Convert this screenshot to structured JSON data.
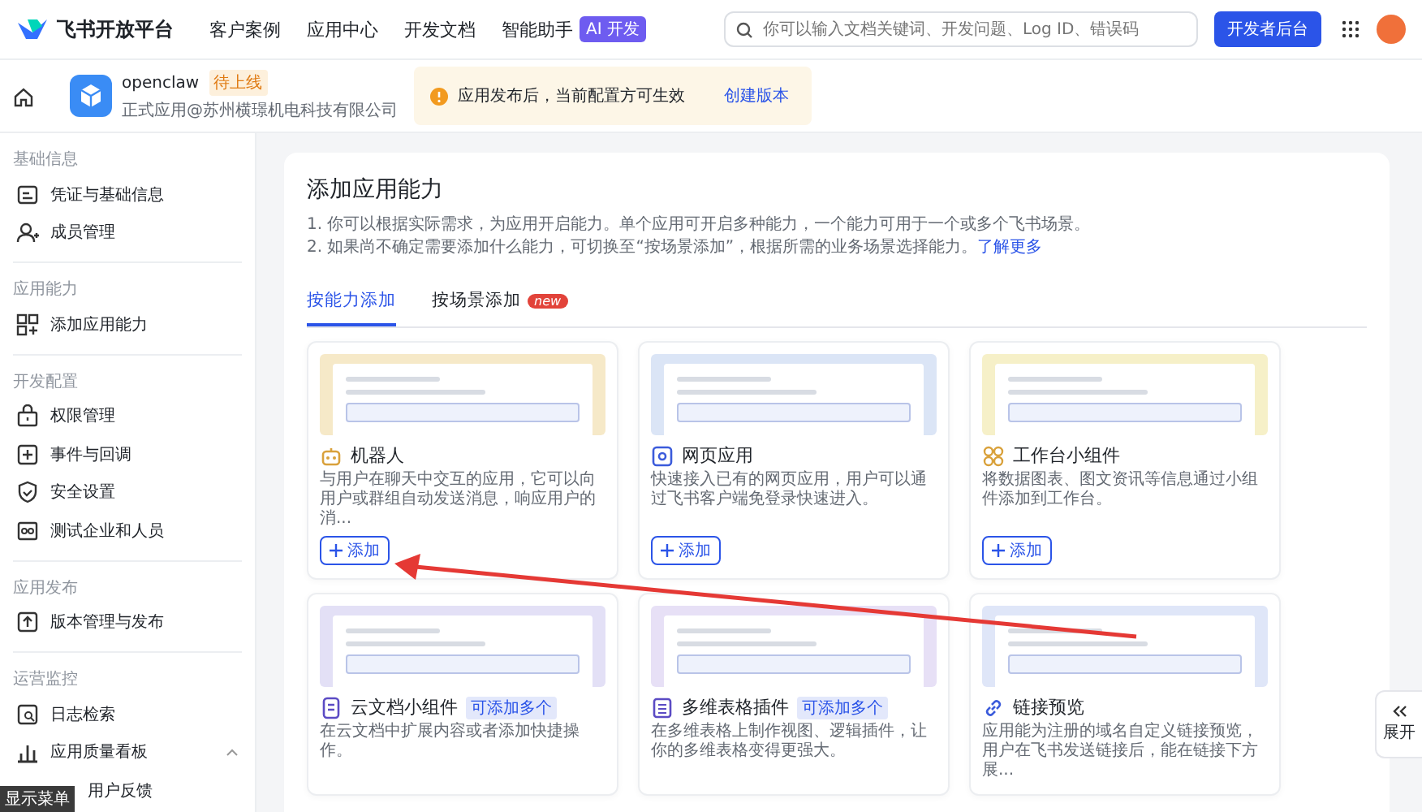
{
  "header": {
    "brand": "飞书开放平台",
    "nav": [
      {
        "label": "客户案例"
      },
      {
        "label": "应用中心"
      },
      {
        "label": "开发文档"
      },
      {
        "label": "智能助手",
        "badge": "AI 开发"
      }
    ],
    "search": {
      "placeholder": "你可以输入文档关键词、开发问题、Log ID、错误码"
    },
    "console_button": "开发者后台"
  },
  "app_bar": {
    "app_name": "openclaw",
    "status_badge": "待上线",
    "subtitle": "正式应用@苏州横璟机电科技有限公司",
    "notice": "应用发布后，当前配置方可生效",
    "notice_link": "创建版本"
  },
  "sidebar": {
    "groups": [
      {
        "heading": "基础信息",
        "items": [
          {
            "label": "凭证与基础信息",
            "kind": "card",
            "selected": false
          },
          {
            "label": "成员管理",
            "kind": "user",
            "selected": false
          }
        ]
      },
      {
        "heading": "应用能力",
        "items": [
          {
            "label": "添加应用能力",
            "kind": "grid",
            "selected": false
          }
        ]
      },
      {
        "heading": "开发配置",
        "items": [
          {
            "label": "权限管理",
            "kind": "lock",
            "selected": false
          },
          {
            "label": "事件与回调",
            "kind": "event",
            "selected": false
          },
          {
            "label": "安全设置",
            "kind": "shield",
            "selected": false
          },
          {
            "label": "测试企业和人员",
            "kind": "test",
            "selected": false
          }
        ]
      },
      {
        "heading": "应用发布",
        "items": [
          {
            "label": "版本管理与发布",
            "kind": "upload",
            "selected": false
          }
        ]
      },
      {
        "heading": "运营监控",
        "items": [
          {
            "label": "日志检索",
            "kind": "log",
            "selected": false
          },
          {
            "label": "应用质量看板",
            "kind": "chart",
            "selected": false,
            "expanded": true,
            "children": [
              {
                "label": "用户反馈",
                "selected": false
              }
            ]
          }
        ]
      }
    ]
  },
  "menu_tooltip": "显示菜单",
  "panel": {
    "title": "添加应用能力",
    "notes": [
      "1. 你可以根据实际需求，为应用开启能力。单个应用可开启多种能力，一个能力可用于一个或多个飞书场景。",
      "2. 如果尚不确定需要添加什么能力，可切换至“按场景添加”，根据所需的业务场景选择能力。"
    ],
    "notes_link": "了解更多",
    "tabs": [
      {
        "label": "按能力添加",
        "selected": true
      },
      {
        "label": "按场景添加",
        "badge": "new",
        "selected": false
      }
    ],
    "cards": [
      {
        "kind": "robot",
        "title": "机器人",
        "description": "与用户在聊天中交互的应用，它可以向用户或群组自动发送消息，响应用户的消...",
        "add_button": "添加",
        "color": "#f6e9c8"
      },
      {
        "kind": "web",
        "title": "网页应用",
        "description": "快速接入已有的网页应用，用户可以通过飞书客户端免登录快速进入。",
        "add_button": "添加",
        "color": "#dbe5f6"
      },
      {
        "kind": "widget",
        "title": "工作台小组件",
        "description": "将数据图表、图文资讯等信息通过小组件添加到工作台。",
        "add_button": "添加",
        "color": "#f6f0c8"
      },
      {
        "kind": "doc",
        "title": "云文档小组件",
        "badge": "可添加多个",
        "description": "在云文档中扩展内容或者添加快捷操作。",
        "color": "#e3e0f6"
      },
      {
        "kind": "table",
        "title": "多维表格插件",
        "badge": "可添加多个",
        "description": "在多维表格上制作视图、逻辑插件，让你的多维表格变得更强大。",
        "color": "#e7e0f6"
      },
      {
        "kind": "link",
        "title": "链接预览",
        "description": "应用能为注册的域名自定义链接预览，用户在飞书发送链接后，能在链接下方展...",
        "color": "#dfe6f8"
      }
    ]
  },
  "expand_button": "展开"
}
